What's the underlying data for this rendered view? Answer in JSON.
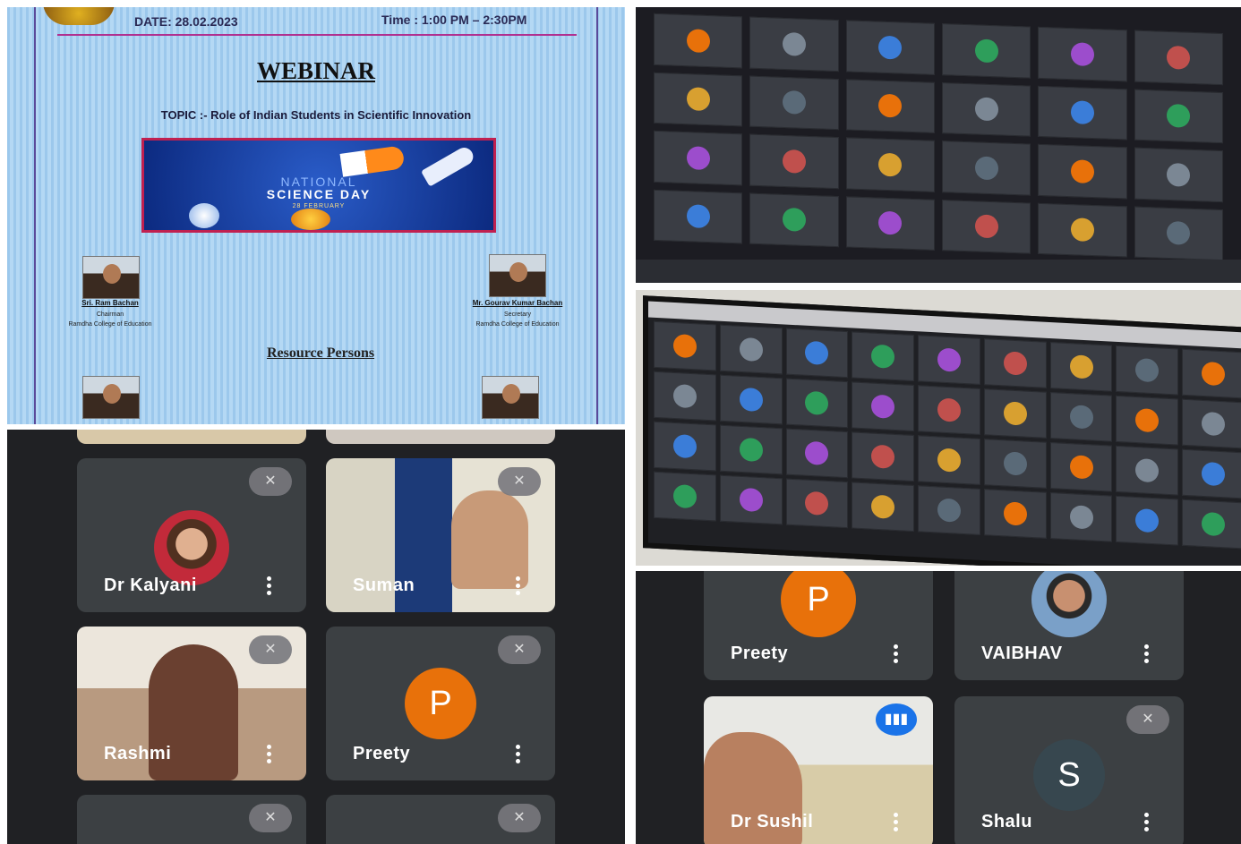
{
  "poster": {
    "date": "DATE: 28.02.2023",
    "time": "Time : 1:00 PM – 2:30PM",
    "title": "WEBINAR",
    "topic": "TOPIC :- Role of Indian Students in Scientific Innovation",
    "banner_line1": "NATIONAL",
    "banner_line2": "SCIENCE DAY",
    "banner_line3": "28 FEBRUARY",
    "left_person": {
      "name": "Sri. Ram Bachan",
      "role": "Chairman",
      "org": "Ramdha College of Education"
    },
    "right_person": {
      "name": "Mr. Gourav Kumar Bachan",
      "role": "Secretary",
      "org": "Ramdha College of Education"
    },
    "resource_heading": "Resource Persons"
  },
  "meet_left": {
    "tiles": [
      {
        "name": "Dr Kalyani"
      },
      {
        "name": "Suman"
      },
      {
        "name": "Rashmi"
      },
      {
        "name": "Preety",
        "initial": "P"
      }
    ]
  },
  "meet_right": {
    "tiles": [
      {
        "name": "Preety",
        "initial": "P"
      },
      {
        "name": "VAIBHAV"
      },
      {
        "name": "Dr Sushil"
      },
      {
        "name": "Shalu",
        "initial": "S"
      }
    ]
  },
  "colors": {
    "meet_bg": "#202124",
    "tile_bg": "#3c4043",
    "avatar_orange": "#e8710a",
    "avatar_slate": "#37474f",
    "speaking_blue": "#1a73e8"
  },
  "icons": {
    "mute": "mic-off-icon",
    "menu": "more-vert-icon",
    "speaking": "audio-level-icon"
  }
}
